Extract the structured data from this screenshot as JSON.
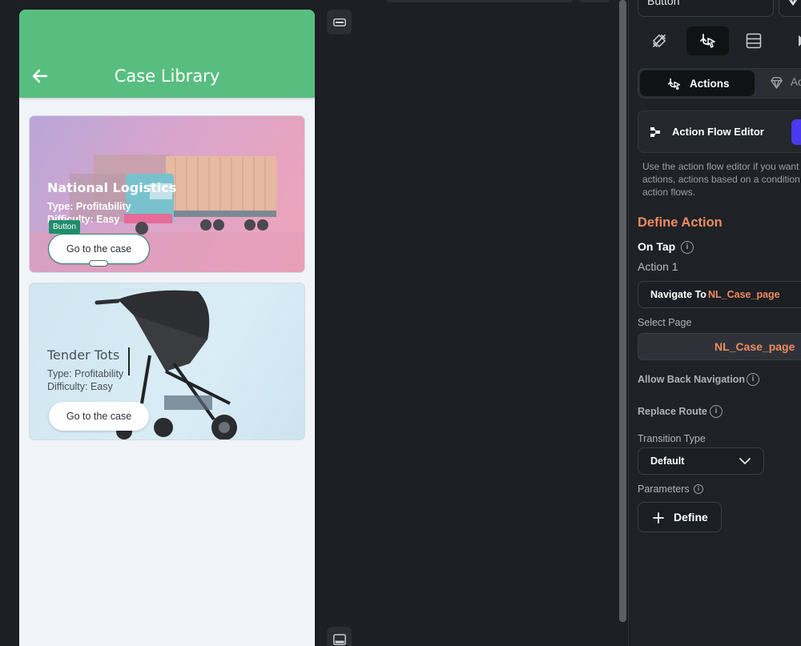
{
  "canvas": {
    "app_bar": {
      "title": "Case Library",
      "bg_color": "#58be7f"
    },
    "cards": [
      {
        "title": "National Logistics",
        "type": "Type: Profitability",
        "difficulty": "Difficulty: Easy",
        "button_label": "Go to the case",
        "selected_widget_tag": "Button"
      },
      {
        "title": "Tender Tots",
        "type": "Type: Profitability",
        "difficulty": "Difficulty: Easy",
        "button_label": "Go to the case"
      }
    ]
  },
  "panel": {
    "widget_name": "Button",
    "tabs": [
      "properties-icon",
      "actions-icon",
      "backend-query-icon",
      "play-icon"
    ],
    "segments": {
      "actions": "Actions",
      "second": "Ac"
    },
    "action_flow_editor": {
      "label": "Action Flow Editor",
      "accent": "#4b39ef"
    },
    "help_text": [
      "Use the action flow editor if you want",
      "actions, actions based on a condition",
      "action flows."
    ],
    "define_action": "Define Action",
    "on_tap": "On Tap",
    "action_1": "Action 1",
    "navigate": {
      "prefix": "Navigate To",
      "page": "NL_Case_page"
    },
    "select_page": {
      "label": "Select Page",
      "value": "NL_Case_page"
    },
    "allow_back_navigation": "Allow Back Navigation",
    "replace_route": "Replace Route",
    "transition_type": {
      "label": "Transition Type",
      "value": "Default"
    },
    "parameters": {
      "label": "Parameters",
      "button": "Define"
    },
    "accent_orange": "#ee8b60"
  }
}
